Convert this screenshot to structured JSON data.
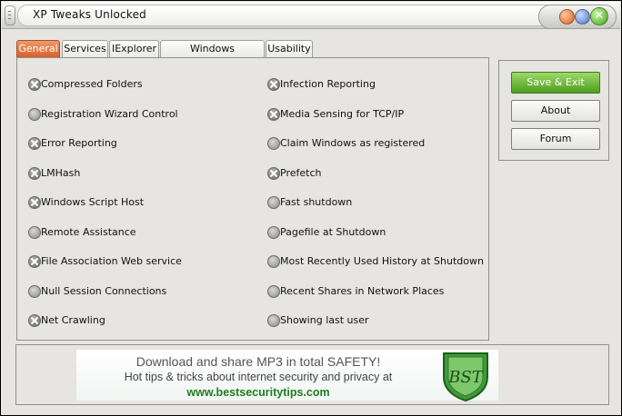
{
  "window": {
    "title": "XP Tweaks Unlocked",
    "close_glyph": "✕"
  },
  "tabs": [
    {
      "label": "General",
      "active": true
    },
    {
      "label": "Services",
      "active": false
    },
    {
      "label": "IExplorer",
      "active": false
    },
    {
      "label": "Windows MediaPlayer",
      "active": false
    },
    {
      "label": "Usability",
      "active": false
    }
  ],
  "options_left": [
    {
      "label": "Compressed Folders",
      "checked": true
    },
    {
      "label": "Registration Wizard Control",
      "checked": false
    },
    {
      "label": "Error Reporting",
      "checked": true
    },
    {
      "label": "LMHash",
      "checked": true
    },
    {
      "label": "Windows Script Host",
      "checked": true
    },
    {
      "label": "Remote Assistance",
      "checked": false
    },
    {
      "label": "File Association Web service",
      "checked": true
    },
    {
      "label": "Null Session Connections",
      "checked": false
    },
    {
      "label": "Net Crawling",
      "checked": true
    }
  ],
  "options_right": [
    {
      "label": "Infection Reporting",
      "checked": true
    },
    {
      "label": "Media Sensing for TCP/IP",
      "checked": true
    },
    {
      "label": "Claim Windows as registered",
      "checked": false
    },
    {
      "label": "Prefetch",
      "checked": true
    },
    {
      "label": "Fast shutdown",
      "checked": false
    },
    {
      "label": "Pagefile at Shutdown",
      "checked": false
    },
    {
      "label": "Most Recently Used History at Shutdown",
      "checked": false
    },
    {
      "label": "Recent Shares in Network Places",
      "checked": false
    },
    {
      "label": "Showing last user",
      "checked": false
    }
  ],
  "buttons": {
    "save_exit": "Save & Exit",
    "about": "About",
    "forum": "Forum"
  },
  "banner": {
    "line1": "Download and share MP3  in total SAFETY!",
    "line2": "Hot tips & tricks about internet security and privacy at",
    "line3": "www.bestsecuritytips.com",
    "logo_text": "BST"
  },
  "colors": {
    "active_tab": "#d9602a",
    "primary_button": "#4c9e1f",
    "link_green": "#1e7d1e"
  }
}
